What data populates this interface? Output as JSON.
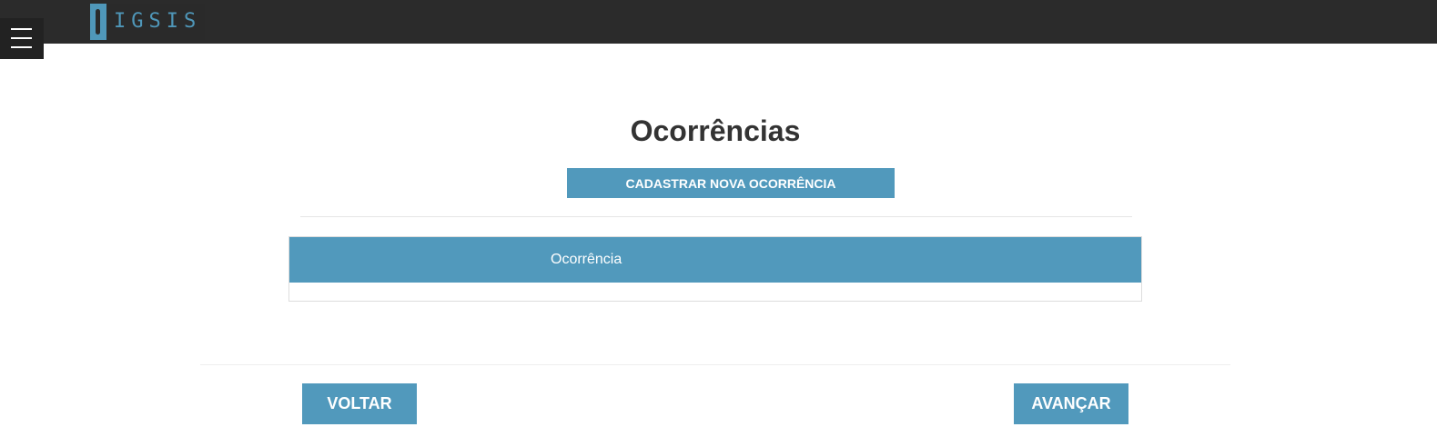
{
  "header": {
    "logo_text": "IGSIS",
    "menu_icon": "hamburger-menu-icon"
  },
  "main": {
    "title": "Ocorrências",
    "add_button_label": "CADASTRAR NOVA OCORRÊNCIA",
    "table": {
      "columns": [
        "Ocorrência"
      ],
      "rows": []
    }
  },
  "footer": {
    "back_label": "VOLTAR",
    "next_label": "AVANÇAR"
  },
  "colors": {
    "topbar": "#2b2b2b",
    "accent": "#5199bc"
  }
}
